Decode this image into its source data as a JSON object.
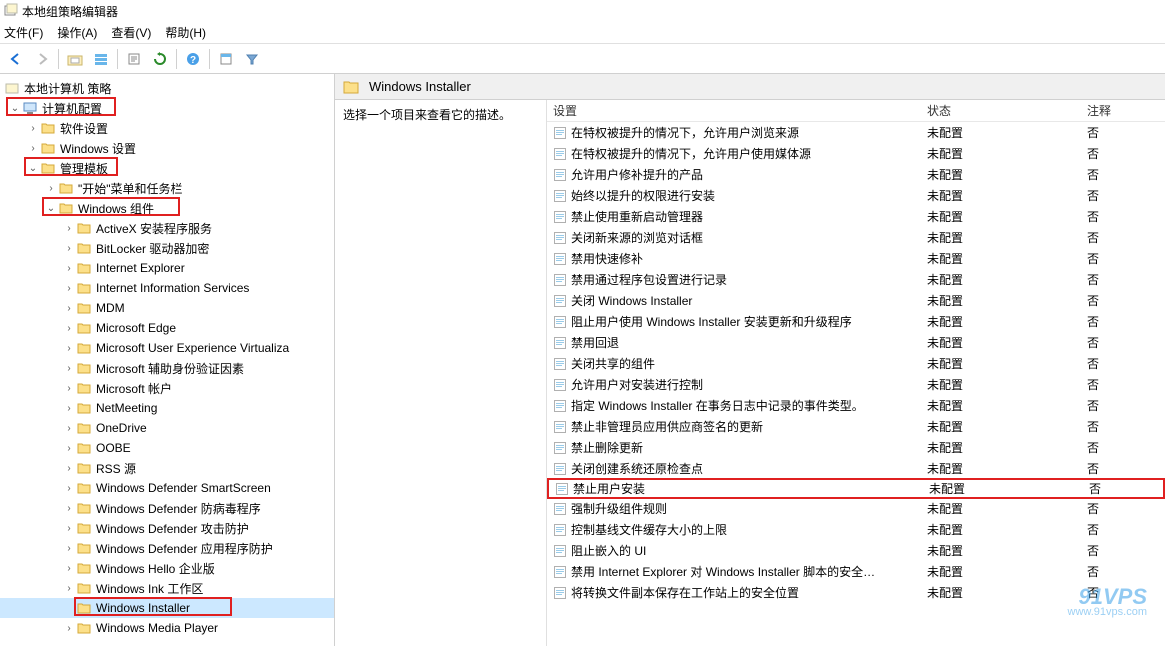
{
  "window_title": "本地组策略编辑器",
  "menu": {
    "file": "文件(F)",
    "action": "操作(A)",
    "view": "查看(V)",
    "help": "帮助(H)"
  },
  "toolbar_icons": [
    "back",
    "forward",
    "up",
    "show-hide",
    "export",
    "refresh",
    "help",
    "properties",
    "filter"
  ],
  "tree": {
    "root": "本地计算机 策略",
    "computer_config": "计算机配置",
    "software_settings": "软件设置",
    "windows_settings": "Windows 设置",
    "admin_templates": "管理模板",
    "start_menu": "\"开始\"菜单和任务栏",
    "windows_components": "Windows 组件",
    "items": [
      "ActiveX 安装程序服务",
      "BitLocker 驱动器加密",
      "Internet Explorer",
      "Internet Information Services",
      "MDM",
      "Microsoft Edge",
      "Microsoft User Experience Virtualiza",
      "Microsoft 辅助身份验证因素",
      "Microsoft 帐户",
      "NetMeeting",
      "OneDrive",
      "OOBE",
      "RSS 源",
      "Windows Defender SmartScreen",
      "Windows Defender 防病毒程序",
      "Windows Defender 攻击防护",
      "Windows Defender 应用程序防护",
      "Windows Hello 企业版",
      "Windows Ink 工作区",
      "Windows Installer",
      "Windows Media Player"
    ]
  },
  "content": {
    "header_title": "Windows Installer",
    "desc_prompt": "选择一个项目来查看它的描述。",
    "columns": {
      "setting": "设置",
      "state": "状态",
      "comment": "注释"
    },
    "state_default": "未配置",
    "comment_default": "否",
    "rows": [
      "在特权被提升的情况下，允许用户浏览来源",
      "在特权被提升的情况下，允许用户使用媒体源",
      "允许用户修补提升的产品",
      "始终以提升的权限进行安装",
      "禁止使用重新启动管理器",
      "关闭新来源的浏览对话框",
      "禁用快速修补",
      "禁用通过程序包设置进行记录",
      "关闭 Windows Installer",
      "阻止用户使用 Windows Installer 安装更新和升级程序",
      "禁用回退",
      "关闭共享的组件",
      "允许用户对安装进行控制",
      "指定 Windows Installer 在事务日志中记录的事件类型。",
      "禁止非管理员应用供应商签名的更新",
      "禁止删除更新",
      "关闭创建系统还原检查点",
      "禁止用户安装",
      "强制升级组件规则",
      "控制基线文件缓存大小的上限",
      "阻止嵌入的 UI",
      "禁用 Internet Explorer 对 Windows Installer 脚本的安全…",
      "将转换文件副本保存在工作站上的安全位置"
    ],
    "highlighted_row_index": 17
  },
  "watermark": {
    "brand": "91VPS",
    "url": "www.91vps.com"
  }
}
